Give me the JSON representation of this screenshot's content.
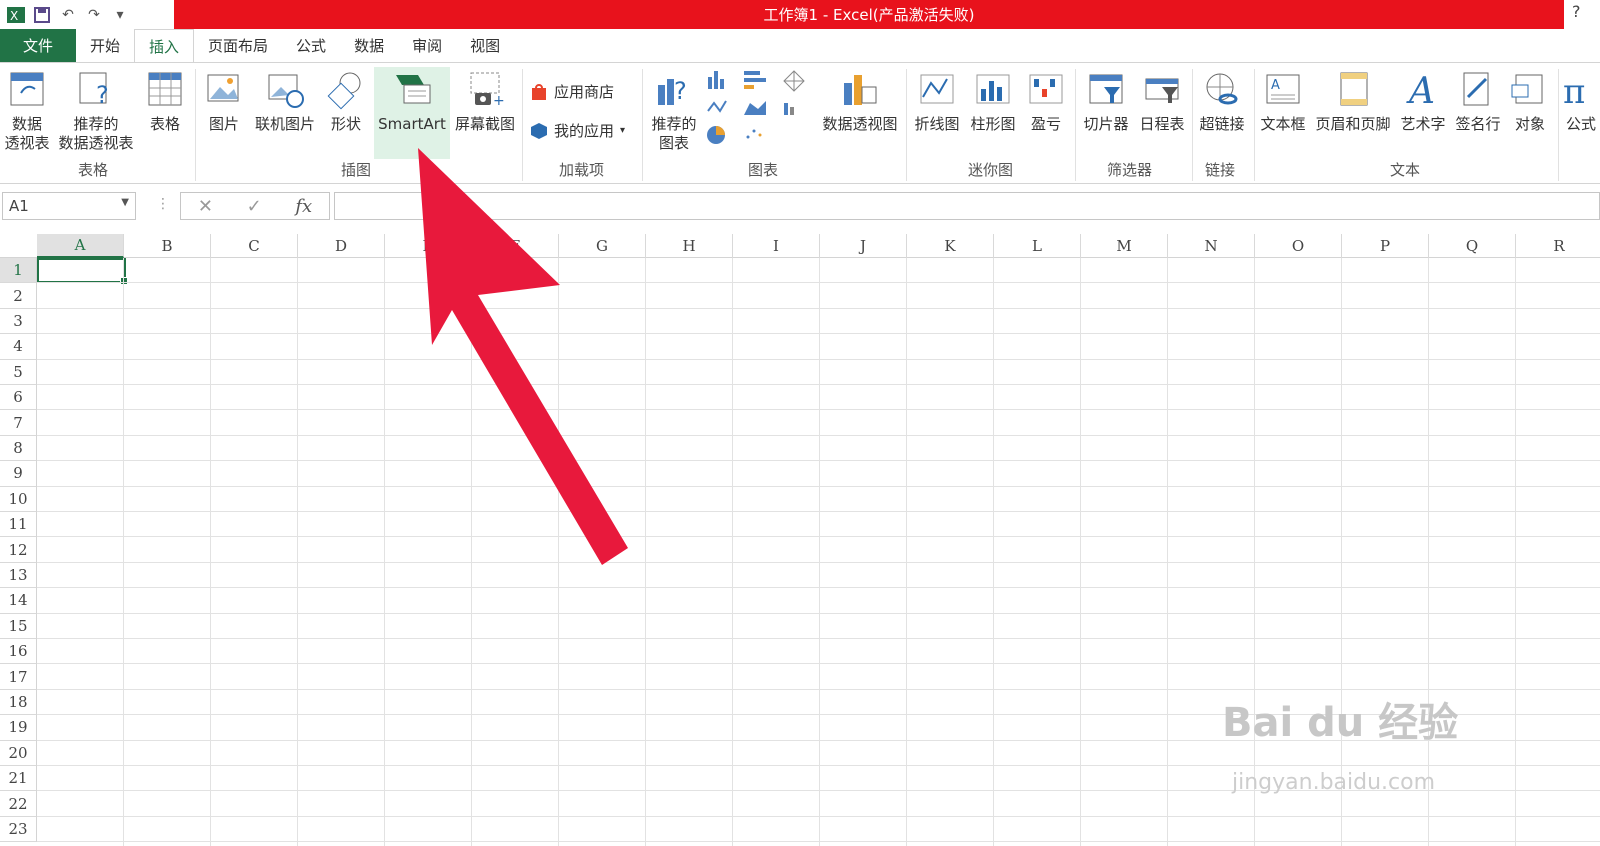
{
  "title_bar": {
    "title": "工作簿1 -  Excel(产品激活失败)",
    "help": "?"
  },
  "tabs": [
    {
      "label": "文件"
    },
    {
      "label": "开始"
    },
    {
      "label": "插入"
    },
    {
      "label": "页面布局"
    },
    {
      "label": "公式"
    },
    {
      "label": "数据"
    },
    {
      "label": "审阅"
    },
    {
      "label": "视图"
    }
  ],
  "ribbon": {
    "tables": {
      "pivot": "数据\n透视表",
      "rec_pivot": "推荐的\n数据透视表",
      "table": "表格",
      "group": "表格"
    },
    "illustrations": {
      "picture": "图片",
      "online_picture": "联机图片",
      "shapes": "形状",
      "smartart": "SmartArt",
      "screenshot": "屏幕截图",
      "group": "插图"
    },
    "addins": {
      "store": "应用商店",
      "my_apps": "我的应用",
      "group": "加载项"
    },
    "charts": {
      "recommended": "推荐的\n图表",
      "pivot_chart": "数据透视图",
      "group": "图表"
    },
    "sparklines": {
      "line": "折线图",
      "column": "柱形图",
      "winloss": "盈亏",
      "group": "迷你图"
    },
    "filters": {
      "slicer": "切片器",
      "timeline": "日程表",
      "group": "筛选器"
    },
    "links": {
      "hyperlink": "超链接",
      "group": "链接"
    },
    "text": {
      "textbox": "文本框",
      "header_footer": "页眉和页脚",
      "wordart": "艺术字",
      "signature": "签名行",
      "object": "对象",
      "group": "文本"
    },
    "symbols": {
      "equation": "公式"
    }
  },
  "formula_bar": {
    "name_box": "A1",
    "fx": "fx"
  },
  "columns": [
    "A",
    "B",
    "C",
    "D",
    "E",
    "F",
    "G",
    "H",
    "I",
    "J",
    "K",
    "L",
    "M",
    "N",
    "O",
    "P",
    "Q",
    "R"
  ],
  "rows": [
    "1",
    "2",
    "3",
    "4",
    "5",
    "6",
    "7",
    "8",
    "9",
    "10",
    "11",
    "12",
    "13",
    "14",
    "15",
    "16",
    "17",
    "18",
    "19",
    "20",
    "21",
    "22",
    "23"
  ],
  "watermark": {
    "brand": "Bai du 经验",
    "url": "jingyan.baidu.com"
  },
  "colors": {
    "accent": "#217346",
    "title_bar": "#e8121c",
    "arrow": "#e8193c"
  }
}
